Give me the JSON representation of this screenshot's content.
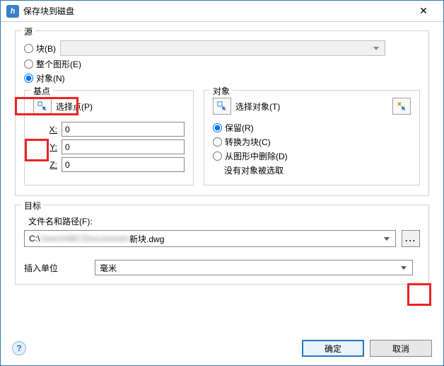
{
  "window": {
    "title": "保存块到磁盘",
    "close_glyph": "✕",
    "icon_glyph": "h"
  },
  "source": {
    "legend": "源",
    "block_label": "块(B)",
    "entire_label": "整个图形(E)",
    "objects_label": "对象(N)",
    "selected": "objects"
  },
  "base": {
    "legend": "基点",
    "pick_label": "选择点(P)",
    "x_label": "X:",
    "y_label": "Y:",
    "z_label": "Z:",
    "x": "0",
    "y": "0",
    "z": "0"
  },
  "objects": {
    "legend": "对象",
    "select_label": "选择对象(T)",
    "retain_label": "保留(R)",
    "convert_label": "转换为块(C)",
    "delete_label": "从图形中删除(D)",
    "selected": "retain",
    "status": "没有对象被选取"
  },
  "target": {
    "legend": "目标",
    "path_label": "文件名和路径(F):",
    "path_prefix": "C:\\",
    "path_blurred_mid": "Users\\ABC\\Documents\\",
    "path_suffix": "新块.dwg",
    "browse_label": "...",
    "units_label": "插入单位",
    "units_value": "毫米"
  },
  "buttons": {
    "help_glyph": "?",
    "ok": "确定",
    "cancel": "取消"
  },
  "icons": {
    "pick_point_icon": "pick-point-icon",
    "select_objects_icon": "select-objects-icon",
    "qselect_icon": "quick-select-icon"
  }
}
